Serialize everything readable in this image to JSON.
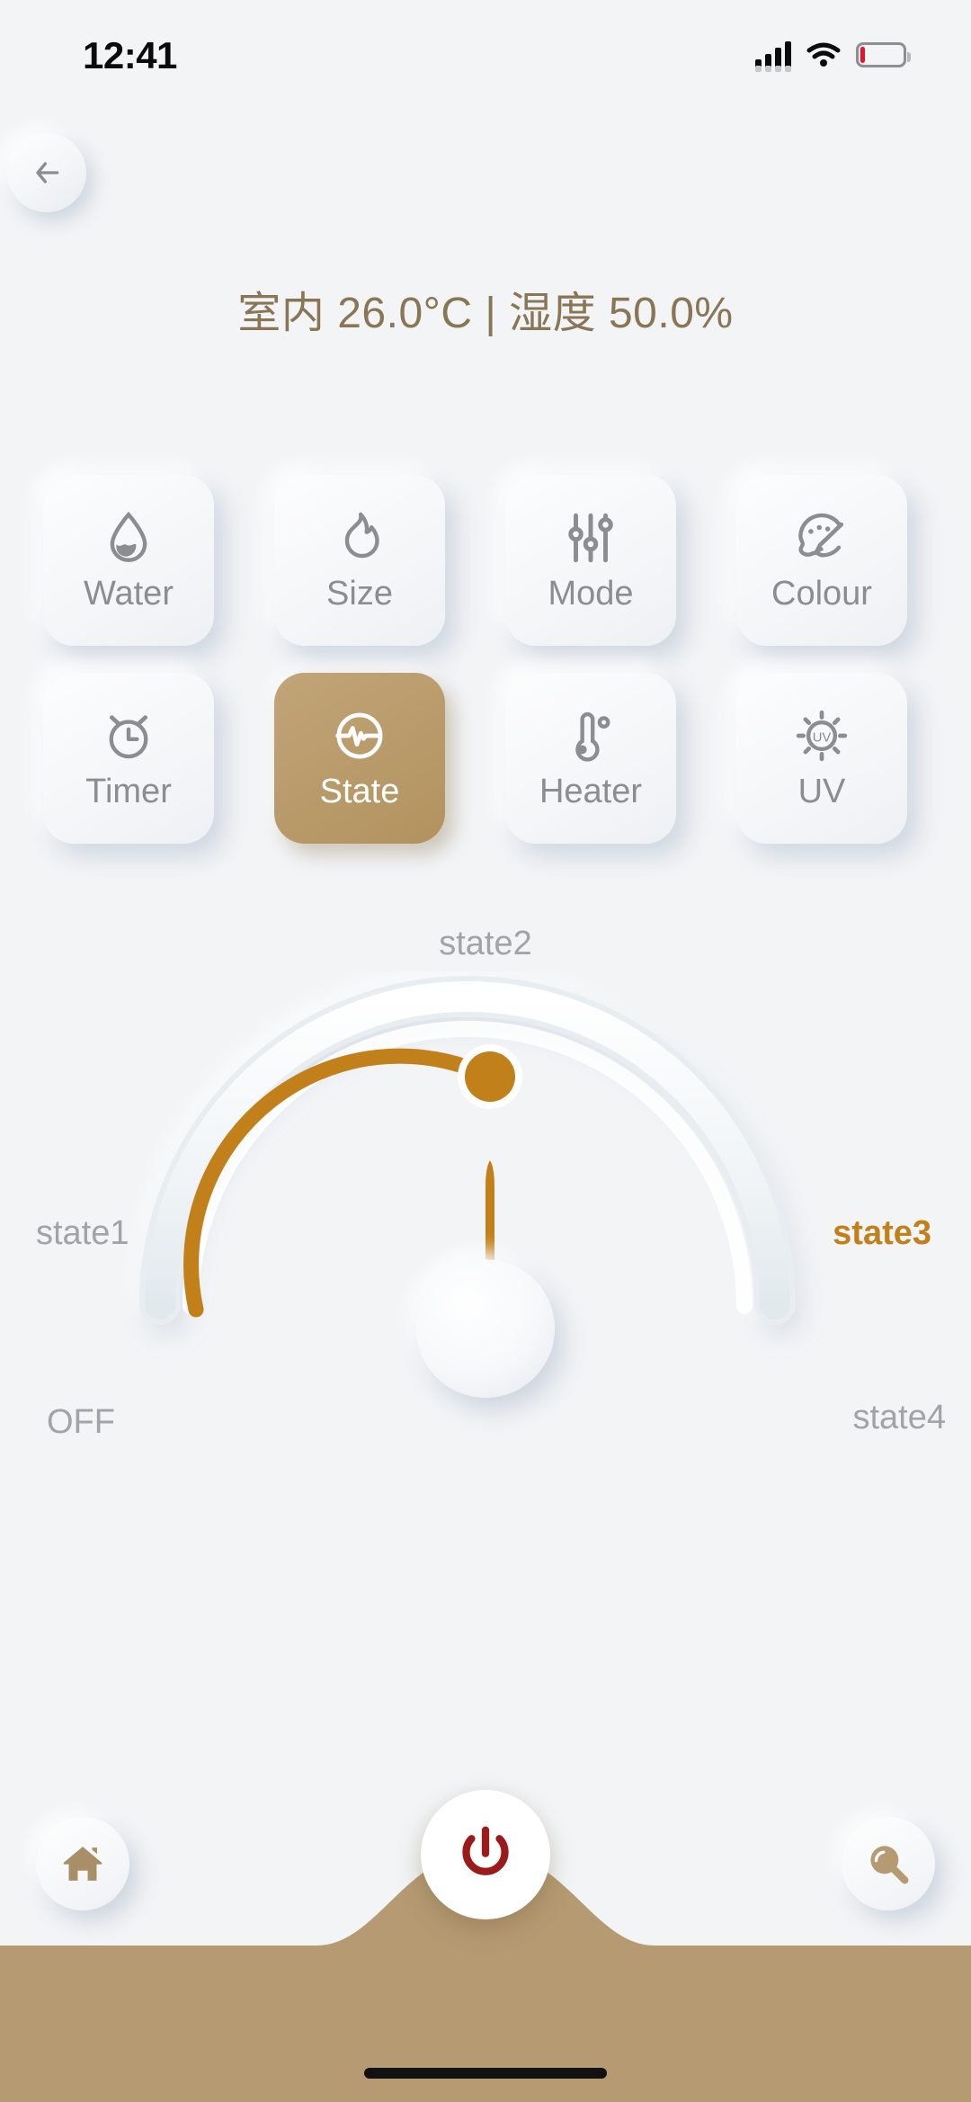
{
  "status_bar": {
    "time": "12:41",
    "signal_icon": "signal-bars-icon",
    "wifi_icon": "wifi-icon",
    "battery_icon": "battery-low-icon"
  },
  "header": {
    "back_icon": "arrow-left-icon",
    "environment_text": "室内 26.0°C | 湿度 50.0%",
    "indoor_temperature": "26.0",
    "temperature_unit": "°C",
    "humidity": "50.0",
    "humidity_unit": "%"
  },
  "controls": {
    "tiles": [
      {
        "label": "Water",
        "icon": "water-drop-icon",
        "active": false
      },
      {
        "label": "Size",
        "icon": "flame-icon",
        "active": false
      },
      {
        "label": "Mode",
        "icon": "sliders-icon",
        "active": false
      },
      {
        "label": "Colour",
        "icon": "palette-icon",
        "active": false
      },
      {
        "label": "Timer",
        "icon": "alarm-clock-icon",
        "active": false
      },
      {
        "label": "State",
        "icon": "pulse-circle-icon",
        "active": true
      },
      {
        "label": "Heater",
        "icon": "thermometer-icon",
        "active": false
      },
      {
        "label": "UV",
        "icon": "uv-sun-icon",
        "active": false
      }
    ]
  },
  "gauge": {
    "labels": {
      "off": "OFF",
      "state1": "state1",
      "state2": "state2",
      "state3": "state3",
      "state4": "state4"
    },
    "selected_label": "state3",
    "track_color": "#e9eef1",
    "progress_color": "#c1801a",
    "knob_color": "#c1801a",
    "needle_color": "#c1801a",
    "needle_angle_deg": 0,
    "progress_fraction": 0.52
  },
  "bottom_nav": {
    "bar_color": "#b59a72",
    "home_icon": "home-icon",
    "power_icon": "power-icon",
    "search_icon": "search-icon",
    "power_icon_color": "#9b1b1b",
    "home_indicator": "home-indicator"
  }
}
